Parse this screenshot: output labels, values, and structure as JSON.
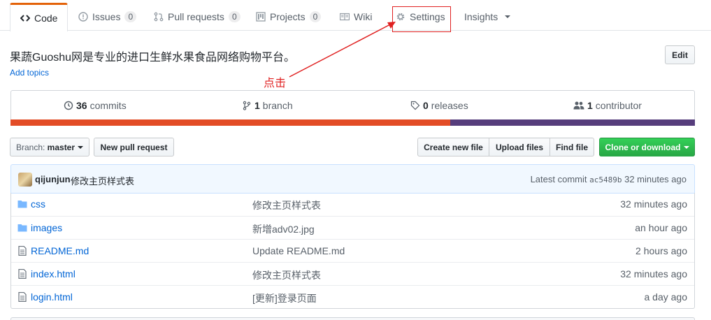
{
  "tabs": [
    {
      "label": "Code",
      "icon": "code-icon",
      "counter": null
    },
    {
      "label": "Issues",
      "icon": "issue-icon",
      "counter": "0"
    },
    {
      "label": "Pull requests",
      "icon": "pull-request-icon",
      "counter": "0"
    },
    {
      "label": "Projects",
      "icon": "project-icon",
      "counter": "0"
    },
    {
      "label": "Wiki",
      "icon": "book-icon",
      "counter": null
    },
    {
      "label": "Settings",
      "icon": "gear-icon",
      "counter": null
    },
    {
      "label": "Insights",
      "icon": null,
      "counter": null
    }
  ],
  "repo": {
    "description": "果蔬Guoshu网是专业的进口生鲜水果食品网络购物平台。",
    "add_topics": "Add topics",
    "edit_label": "Edit"
  },
  "annotation": {
    "text": "点击",
    "color": "#e02020"
  },
  "summary": {
    "commits": {
      "count": "36",
      "label": "commits"
    },
    "branches": {
      "count": "1",
      "label": "branch"
    },
    "releases": {
      "count": "0",
      "label": "releases"
    },
    "contributors": {
      "count": "1",
      "label": "contributor"
    }
  },
  "languages": [
    {
      "color": "#e34c26",
      "fraction": 0.643
    },
    {
      "color": "#563d7c",
      "fraction": 0.357
    }
  ],
  "file_nav": {
    "branch_prefix": "Branch:",
    "branch_name": "master",
    "new_pull_request": "New pull request",
    "create_new_file": "Create new file",
    "upload_files": "Upload files",
    "find_file": "Find file",
    "clone_or_download": "Clone or download"
  },
  "commit": {
    "author": "qijunjun",
    "message": "修改主页样式表",
    "latest_prefix": "Latest commit",
    "sha": "ac5489b",
    "age": "32 minutes ago"
  },
  "files": [
    {
      "name": "css",
      "type": "folder",
      "message": "修改主页样式表",
      "age": "32 minutes ago"
    },
    {
      "name": "images",
      "type": "folder",
      "message": "新增adv02.jpg",
      "age": "an hour ago"
    },
    {
      "name": "README.md",
      "type": "file",
      "message": "Update README.md",
      "age": "2 hours ago"
    },
    {
      "name": "index.html",
      "type": "file",
      "message": "修改主页样式表",
      "age": "32 minutes ago"
    },
    {
      "name": "login.html",
      "type": "file",
      "message": "[更新]登录页面",
      "age": "a day ago"
    }
  ],
  "colors": {
    "accent_tab": "#e36209",
    "link": "#0366d6",
    "green": "#28a745"
  }
}
